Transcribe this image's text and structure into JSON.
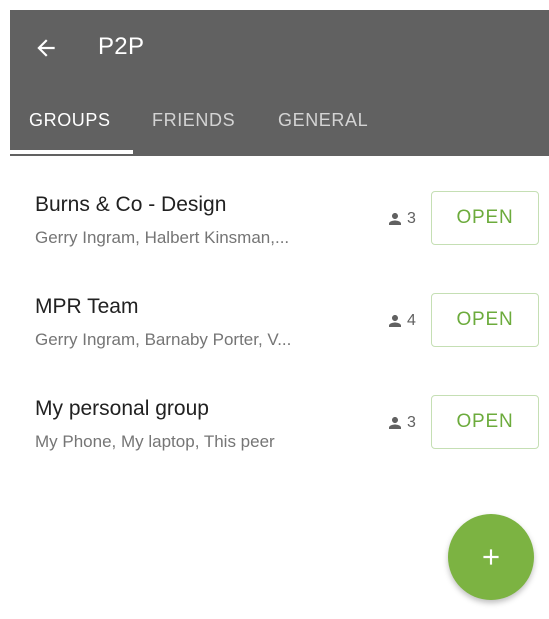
{
  "app": {
    "title": "P2P",
    "back_icon": "arrow-left-icon",
    "colors": {
      "appbar": "#616161",
      "accent": "#7cb342",
      "open_text": "#6cab3c"
    }
  },
  "tabs": [
    {
      "label": "GROUPS",
      "active": true
    },
    {
      "label": "FRIENDS",
      "active": false
    },
    {
      "label": "GENERAL",
      "active": false
    }
  ],
  "groups": [
    {
      "name": "Burns & Co - Design",
      "members": "Gerry Ingram, Halbert Kinsman,...",
      "count": "3",
      "action": "OPEN"
    },
    {
      "name": "MPR Team",
      "members": "Gerry Ingram, Barnaby Porter, V...",
      "count": "4",
      "action": "OPEN"
    },
    {
      "name": "My personal group",
      "members": "My Phone, My laptop, This peer",
      "count": "3",
      "action": "OPEN"
    }
  ],
  "fab": {
    "label": "+",
    "icon": "plus-icon"
  }
}
